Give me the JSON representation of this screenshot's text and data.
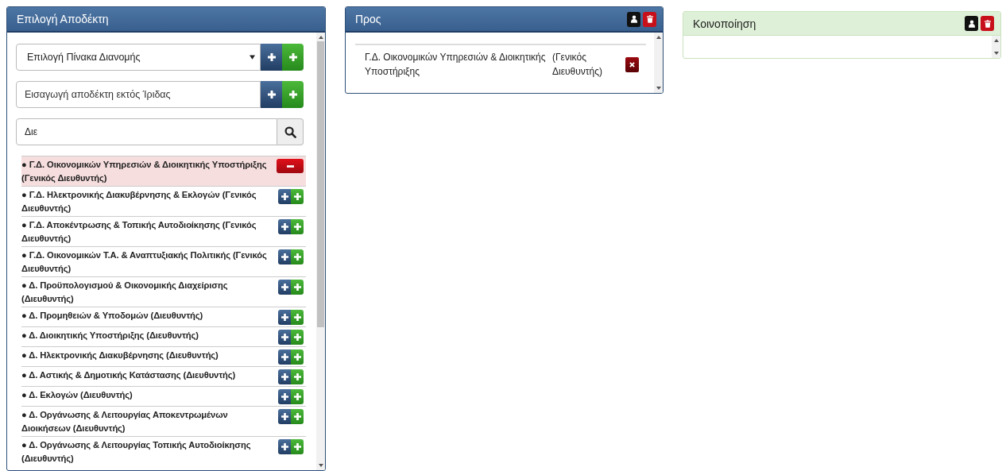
{
  "left_panel": {
    "title": "Επιλογή Αποδέκτη",
    "distribution_select": {
      "value": "Επιλογή Πίνακα Διανομής"
    },
    "external_field": {
      "placeholder": "Εισαγωγή αποδέκτη εκτός Ίριδας"
    },
    "search_field": {
      "value": "Διε"
    },
    "items": [
      {
        "text": "● Γ.Δ. Οικονομικών Υπηρεσιών & Διοικητικής Υποστήριξης (Γενικός Διευθυντής)",
        "selected": true
      },
      {
        "text": "● Γ.Δ. Ηλεκτρονικής Διακυβέρνησης & Εκλογών (Γενικός Διευθυντής)",
        "selected": false
      },
      {
        "text": "● Γ.Δ. Αποκέντρωσης & Τοπικής Αυτοδιοίκησης (Γενικός Διευθυντής)",
        "selected": false
      },
      {
        "text": "● Γ.Δ. Οικονομικών Τ.Α. & Αναπτυξιακής Πολιτικής (Γενικός Διευθυντής)",
        "selected": false
      },
      {
        "text": "● Δ. Προϋπολογισμού & Οικονομικής Διαχείρισης (Διευθυντής)",
        "selected": false
      },
      {
        "text": "● Δ. Προμηθειών & Υποδομών (Διευθυντής)",
        "selected": false
      },
      {
        "text": "● Δ. Διοικητικής Υποστήριξης (Διευθυντής)",
        "selected": false
      },
      {
        "text": "● Δ. Ηλεκτρονικής Διακυβέρνησης (Διευθυντής)",
        "selected": false
      },
      {
        "text": "● Δ. Αστικής & Δημοτικής Κατάστασης (Διευθυντής)",
        "selected": false
      },
      {
        "text": "● Δ. Εκλογών (Διευθυντής)",
        "selected": false
      },
      {
        "text": "● Δ. Οργάνωσης & Λειτουργίας Αποκεντρωμένων Διοικήσεων (Διευθυντής)",
        "selected": false
      },
      {
        "text": "● Δ. Οργάνωσης & Λειτουργίας Τοπικής Αυτοδιοίκησης (Διευθυντής)",
        "selected": false
      }
    ]
  },
  "to_panel": {
    "title": "Προς",
    "recipients": [
      {
        "name": "Γ.Δ. Οικονομικών Υπηρεσιών & Διοικητικής Υποστήριξης",
        "role": "(Γενικός Διευθυντής)"
      }
    ]
  },
  "cc_panel": {
    "title": "Κοινοποίηση"
  }
}
